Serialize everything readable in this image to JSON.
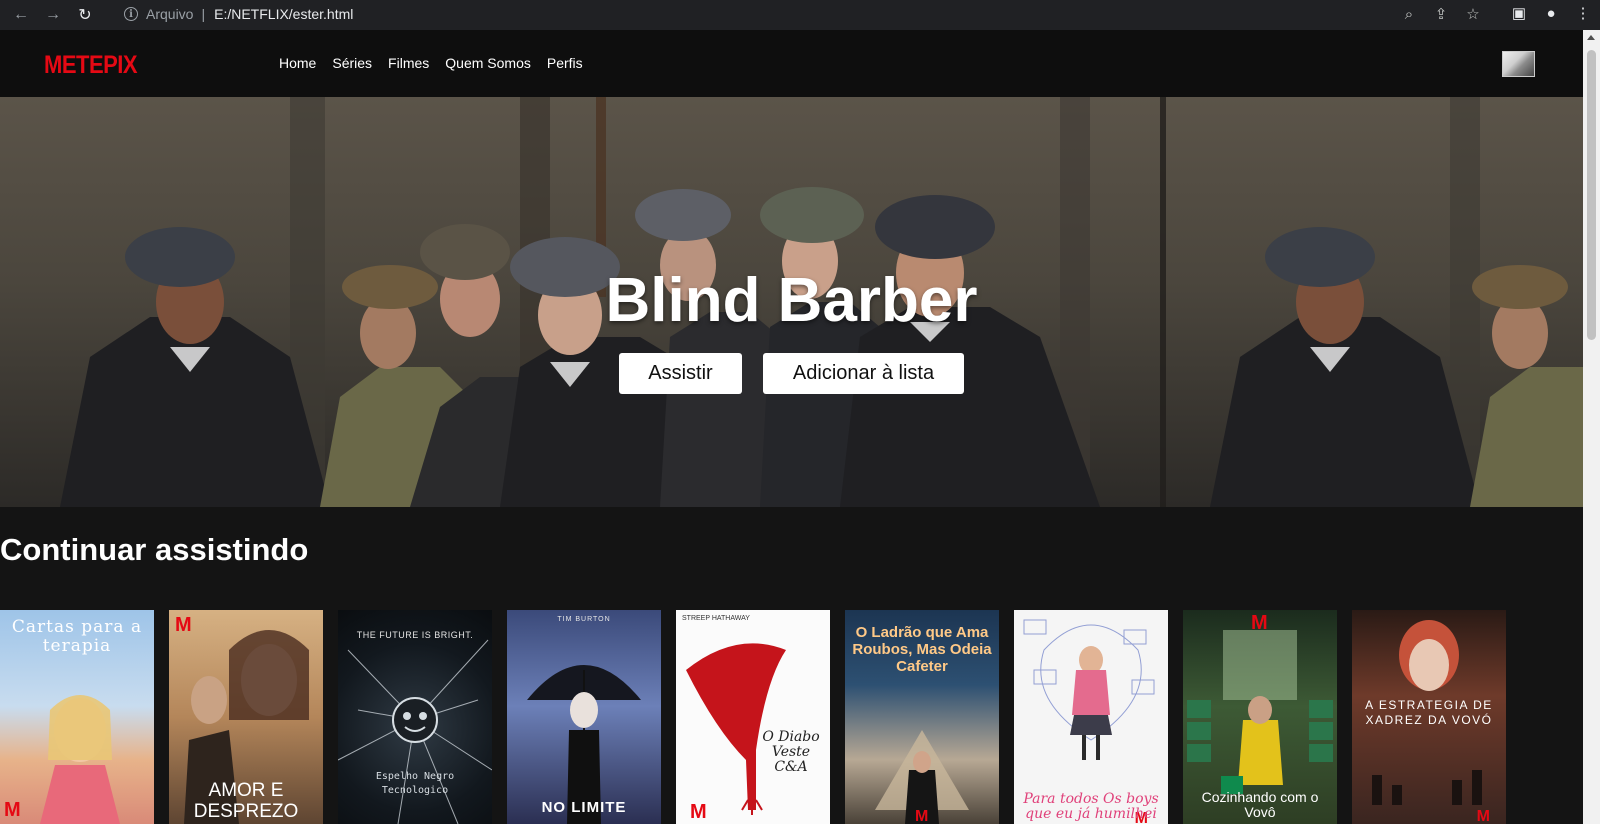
{
  "browser": {
    "scheme_label": "Arquivo",
    "url": "E:/NETFLIX/ester.html"
  },
  "site": {
    "logo": "METEPIX",
    "nav": [
      "Home",
      "Séries",
      "Filmes",
      "Quem Somos",
      "Perfis"
    ]
  },
  "hero": {
    "title": "Blind Barber",
    "watch_label": "Assistir",
    "add_label": "Adicionar à lista"
  },
  "continue_row": {
    "title": "Continuar assistindo",
    "posters": [
      {
        "title": "Cartas para a terapia"
      },
      {
        "title": "AMOR E DESPREZO"
      },
      {
        "title": "Espelho Negro Tecnologico",
        "tag": "THE FUTURE IS BRIGHT."
      },
      {
        "title": "NO LIMITE",
        "tag": "TIM BURTON"
      },
      {
        "title": "O Diabo Veste C&A",
        "tag": "STREEP HATHAWAY"
      },
      {
        "title": "O Ladrão que Ama Roubos, Mas Odeia Cafeter"
      },
      {
        "title": "Para todos Os boys que eu já humilhei"
      },
      {
        "title": "Cozinhando com o Vovô"
      },
      {
        "title": "A ESTRATEGIA DE XADREZ DA VOVÓ"
      }
    ]
  },
  "colors": {
    "brand_red": "#e50914",
    "page_bg": "#141414",
    "header_bg": "#0e0e0e"
  }
}
